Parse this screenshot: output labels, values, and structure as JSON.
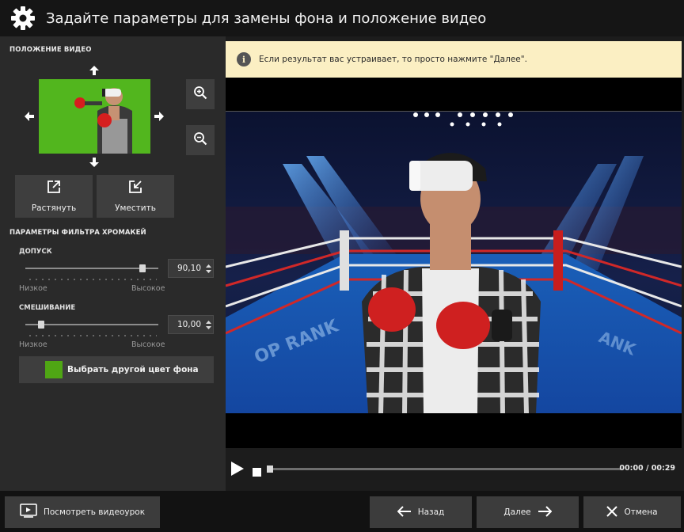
{
  "window": {
    "title": "Задайте параметры для замены фона и положение видео"
  },
  "position_section": {
    "title": "ПОЛОЖЕНИЕ ВИДЕО",
    "stretch_label": "Растянуть",
    "fit_label": "Уместить"
  },
  "chroma_section": {
    "title": "ПАРАМЕТРЫ ФИЛЬТРА ХРОМАКЕЙ",
    "tolerance": {
      "label": "ДОПУСК",
      "value": "90,10",
      "level": 0.88,
      "low_label": "Низкое",
      "high_label": "Высокое"
    },
    "blending": {
      "label": "СМЕШИВАНИЕ",
      "value": "10,00",
      "level": 0.12,
      "low_label": "Низкое",
      "high_label": "Высокое"
    },
    "color_button_label": "Выбрать другой цвет фона",
    "key_color": "#4fa614"
  },
  "preview": {
    "info_text": "Если результат вас устраивает, то просто нажмите \"Далее\".",
    "time": "00:00 / 00:29",
    "progress": 0
  },
  "footer": {
    "tutorial_label": "Посмотреть видеоурок",
    "back_label": "Назад",
    "next_label": "Далее",
    "cancel_label": "Отмена"
  },
  "icons": [
    "gear-icon",
    "arrow-up-icon",
    "arrow-down-icon",
    "arrow-left-icon",
    "arrow-right-icon",
    "zoom-in-icon",
    "zoom-out-icon",
    "stretch-icon",
    "fit-icon",
    "info-icon",
    "play-icon",
    "stop-icon",
    "video-tutorial-icon",
    "arrow-back-icon",
    "arrow-next-icon",
    "close-icon"
  ]
}
